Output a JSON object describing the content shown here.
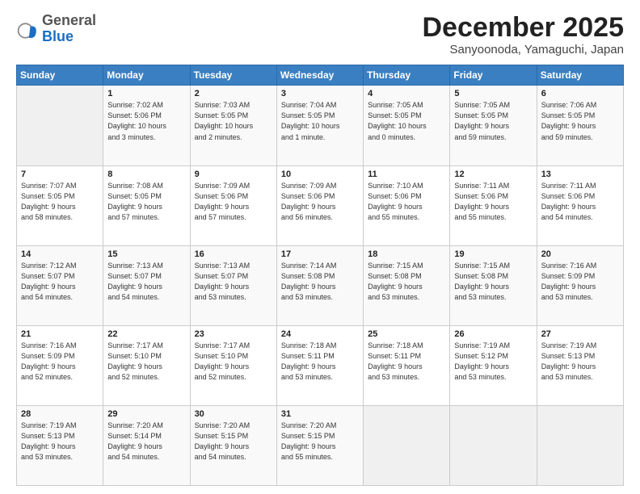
{
  "header": {
    "logo_general": "General",
    "logo_blue": "Blue",
    "month_title": "December 2025",
    "location": "Sanyoonoda, Yamaguchi, Japan"
  },
  "weekdays": [
    "Sunday",
    "Monday",
    "Tuesday",
    "Wednesday",
    "Thursday",
    "Friday",
    "Saturday"
  ],
  "weeks": [
    [
      {
        "day": "",
        "info": ""
      },
      {
        "day": "1",
        "info": "Sunrise: 7:02 AM\nSunset: 5:06 PM\nDaylight: 10 hours\nand 3 minutes."
      },
      {
        "day": "2",
        "info": "Sunrise: 7:03 AM\nSunset: 5:05 PM\nDaylight: 10 hours\nand 2 minutes."
      },
      {
        "day": "3",
        "info": "Sunrise: 7:04 AM\nSunset: 5:05 PM\nDaylight: 10 hours\nand 1 minute."
      },
      {
        "day": "4",
        "info": "Sunrise: 7:05 AM\nSunset: 5:05 PM\nDaylight: 10 hours\nand 0 minutes."
      },
      {
        "day": "5",
        "info": "Sunrise: 7:05 AM\nSunset: 5:05 PM\nDaylight: 9 hours\nand 59 minutes."
      },
      {
        "day": "6",
        "info": "Sunrise: 7:06 AM\nSunset: 5:05 PM\nDaylight: 9 hours\nand 59 minutes."
      }
    ],
    [
      {
        "day": "7",
        "info": "Sunrise: 7:07 AM\nSunset: 5:05 PM\nDaylight: 9 hours\nand 58 minutes."
      },
      {
        "day": "8",
        "info": "Sunrise: 7:08 AM\nSunset: 5:05 PM\nDaylight: 9 hours\nand 57 minutes."
      },
      {
        "day": "9",
        "info": "Sunrise: 7:09 AM\nSunset: 5:06 PM\nDaylight: 9 hours\nand 57 minutes."
      },
      {
        "day": "10",
        "info": "Sunrise: 7:09 AM\nSunset: 5:06 PM\nDaylight: 9 hours\nand 56 minutes."
      },
      {
        "day": "11",
        "info": "Sunrise: 7:10 AM\nSunset: 5:06 PM\nDaylight: 9 hours\nand 55 minutes."
      },
      {
        "day": "12",
        "info": "Sunrise: 7:11 AM\nSunset: 5:06 PM\nDaylight: 9 hours\nand 55 minutes."
      },
      {
        "day": "13",
        "info": "Sunrise: 7:11 AM\nSunset: 5:06 PM\nDaylight: 9 hours\nand 54 minutes."
      }
    ],
    [
      {
        "day": "14",
        "info": "Sunrise: 7:12 AM\nSunset: 5:07 PM\nDaylight: 9 hours\nand 54 minutes."
      },
      {
        "day": "15",
        "info": "Sunrise: 7:13 AM\nSunset: 5:07 PM\nDaylight: 9 hours\nand 54 minutes."
      },
      {
        "day": "16",
        "info": "Sunrise: 7:13 AM\nSunset: 5:07 PM\nDaylight: 9 hours\nand 53 minutes."
      },
      {
        "day": "17",
        "info": "Sunrise: 7:14 AM\nSunset: 5:08 PM\nDaylight: 9 hours\nand 53 minutes."
      },
      {
        "day": "18",
        "info": "Sunrise: 7:15 AM\nSunset: 5:08 PM\nDaylight: 9 hours\nand 53 minutes."
      },
      {
        "day": "19",
        "info": "Sunrise: 7:15 AM\nSunset: 5:08 PM\nDaylight: 9 hours\nand 53 minutes."
      },
      {
        "day": "20",
        "info": "Sunrise: 7:16 AM\nSunset: 5:09 PM\nDaylight: 9 hours\nand 53 minutes."
      }
    ],
    [
      {
        "day": "21",
        "info": "Sunrise: 7:16 AM\nSunset: 5:09 PM\nDaylight: 9 hours\nand 52 minutes."
      },
      {
        "day": "22",
        "info": "Sunrise: 7:17 AM\nSunset: 5:10 PM\nDaylight: 9 hours\nand 52 minutes."
      },
      {
        "day": "23",
        "info": "Sunrise: 7:17 AM\nSunset: 5:10 PM\nDaylight: 9 hours\nand 52 minutes."
      },
      {
        "day": "24",
        "info": "Sunrise: 7:18 AM\nSunset: 5:11 PM\nDaylight: 9 hours\nand 53 minutes."
      },
      {
        "day": "25",
        "info": "Sunrise: 7:18 AM\nSunset: 5:11 PM\nDaylight: 9 hours\nand 53 minutes."
      },
      {
        "day": "26",
        "info": "Sunrise: 7:19 AM\nSunset: 5:12 PM\nDaylight: 9 hours\nand 53 minutes."
      },
      {
        "day": "27",
        "info": "Sunrise: 7:19 AM\nSunset: 5:13 PM\nDaylight: 9 hours\nand 53 minutes."
      }
    ],
    [
      {
        "day": "28",
        "info": "Sunrise: 7:19 AM\nSunset: 5:13 PM\nDaylight: 9 hours\nand 53 minutes."
      },
      {
        "day": "29",
        "info": "Sunrise: 7:20 AM\nSunset: 5:14 PM\nDaylight: 9 hours\nand 54 minutes."
      },
      {
        "day": "30",
        "info": "Sunrise: 7:20 AM\nSunset: 5:15 PM\nDaylight: 9 hours\nand 54 minutes."
      },
      {
        "day": "31",
        "info": "Sunrise: 7:20 AM\nSunset: 5:15 PM\nDaylight: 9 hours\nand 55 minutes."
      },
      {
        "day": "",
        "info": ""
      },
      {
        "day": "",
        "info": ""
      },
      {
        "day": "",
        "info": ""
      }
    ]
  ]
}
